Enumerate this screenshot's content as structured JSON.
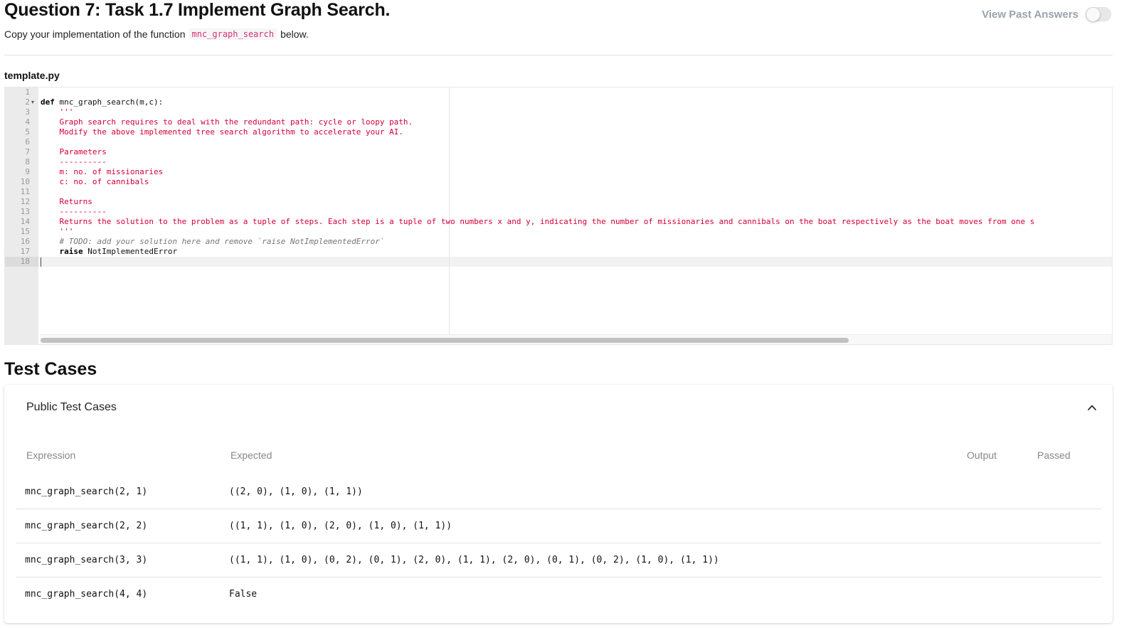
{
  "header": {
    "title": "Question 7: Task 1.7 Implement Graph Search.",
    "subtitle_prefix": "Copy your implementation of the function",
    "function_name": "mnc_graph_search",
    "subtitle_suffix": "below.",
    "past_answers_label": "View Past Answers",
    "past_answers_enabled": false
  },
  "editor": {
    "filename": "template.py",
    "line_numbers": [
      "1",
      "2",
      "3",
      "4",
      "5",
      "6",
      "7",
      "8",
      "9",
      "10",
      "11",
      "12",
      "13",
      "14",
      "15",
      "16",
      "17",
      "18"
    ],
    "active_line": 18,
    "lines": {
      "l2_kw": "def",
      "l2_rest": " mnc_graph_search(m,c):",
      "l3": "    '''",
      "l4": "    Graph search requires to deal with the redundant path: cycle or loopy path.",
      "l5": "    Modify the above implemented tree search algorithm to accelerate your AI.",
      "l7": "    Parameters",
      "l8": "    ----------",
      "l9": "    m: no. of missionaries",
      "l10": "    c: no. of cannibals",
      "l12": "    Returns",
      "l13": "    ----------",
      "l14": "    Returns the solution to the problem as a tuple of steps. Each step is a tuple of two numbers x and y, indicating the number of missionaries and cannibals on the boat respectively as the boat moves from one s",
      "l15": "    '''",
      "l16": "    # TODO: add your solution here and remove `raise NotImplementedError`",
      "l17_kw": "    raise",
      "l17_rest": " NotImplementedError"
    }
  },
  "tests": {
    "heading": "Test Cases",
    "card_title": "Public Test Cases",
    "columns": {
      "expression": "Expression",
      "expected": "Expected",
      "output": "Output",
      "passed": "Passed"
    },
    "rows": [
      {
        "expression": "mnc_graph_search(2, 1)",
        "expected": "((2, 0), (1, 0), (1, 1))"
      },
      {
        "expression": "mnc_graph_search(2, 2)",
        "expected": "((1, 1), (1, 0), (2, 0), (1, 0), (1, 1))"
      },
      {
        "expression": "mnc_graph_search(3, 3)",
        "expected": "((1, 1), (1, 0), (0, 2), (0, 1), (2, 0), (1, 1), (2, 0), (0, 1), (0, 2), (1, 0), (1, 1))"
      },
      {
        "expression": "mnc_graph_search(4, 4)",
        "expected": "False"
      }
    ]
  },
  "colors": {
    "string": "#d10037",
    "inline_code": "#d6336c",
    "comment": "#777777",
    "muted": "#9aa3ab"
  }
}
